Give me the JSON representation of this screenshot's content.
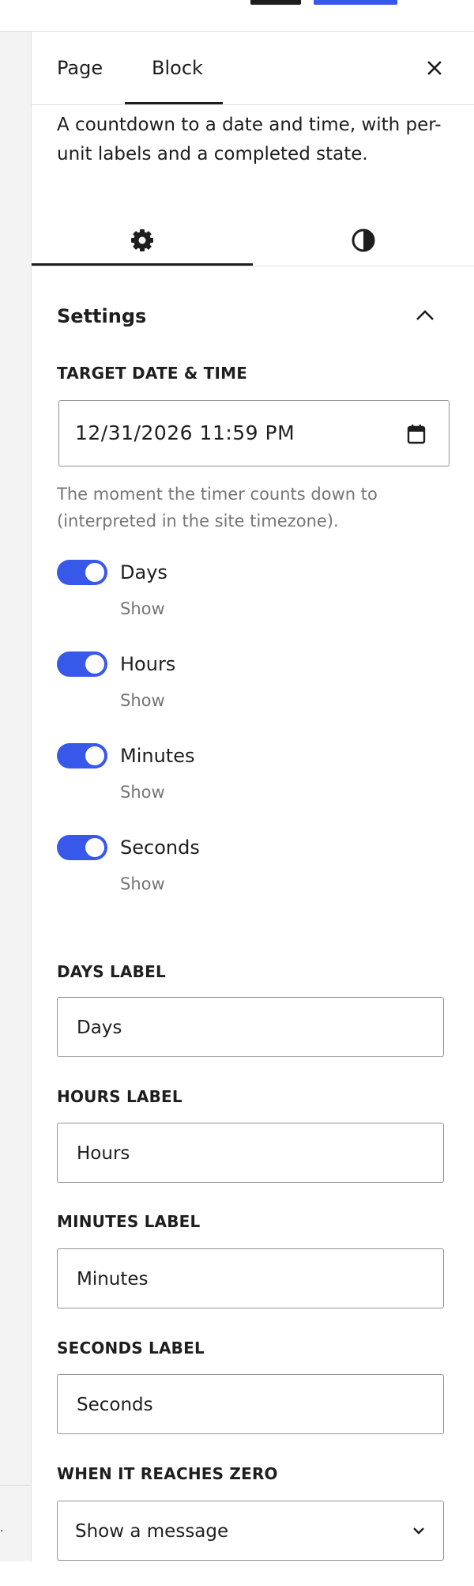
{
  "header": {
    "tabs": [
      "Page",
      "Block"
    ],
    "active_tab": "Block"
  },
  "block": {
    "description": "A countdown to a date and time, with per-unit labels and a completed state."
  },
  "settings_panel": {
    "title": "Settings",
    "target": {
      "label": "Target date & time",
      "value": "12/31/2026 11:59 PM",
      "help": "The moment the timer counts down to (interpreted in the site timezone)."
    },
    "toggles": [
      {
        "label": "Days",
        "help": "Show",
        "checked": true
      },
      {
        "label": "Hours",
        "help": "Show",
        "checked": true
      },
      {
        "label": "Minutes",
        "help": "Show",
        "checked": true
      },
      {
        "label": "Seconds",
        "help": "Show",
        "checked": true
      }
    ],
    "text_fields": [
      {
        "label": "Days label",
        "value": "Days"
      },
      {
        "label": "Hours label",
        "value": "Hours"
      },
      {
        "label": "Minutes label",
        "value": "Minutes"
      },
      {
        "label": "Seconds label",
        "value": "Seconds"
      }
    ],
    "completion": {
      "label": "When it reaches zero",
      "selected": "Show a message"
    }
  },
  "colors": {
    "accent": "#3858e9",
    "text": "#1e1e1e",
    "muted": "#757575",
    "border": "#949494"
  }
}
